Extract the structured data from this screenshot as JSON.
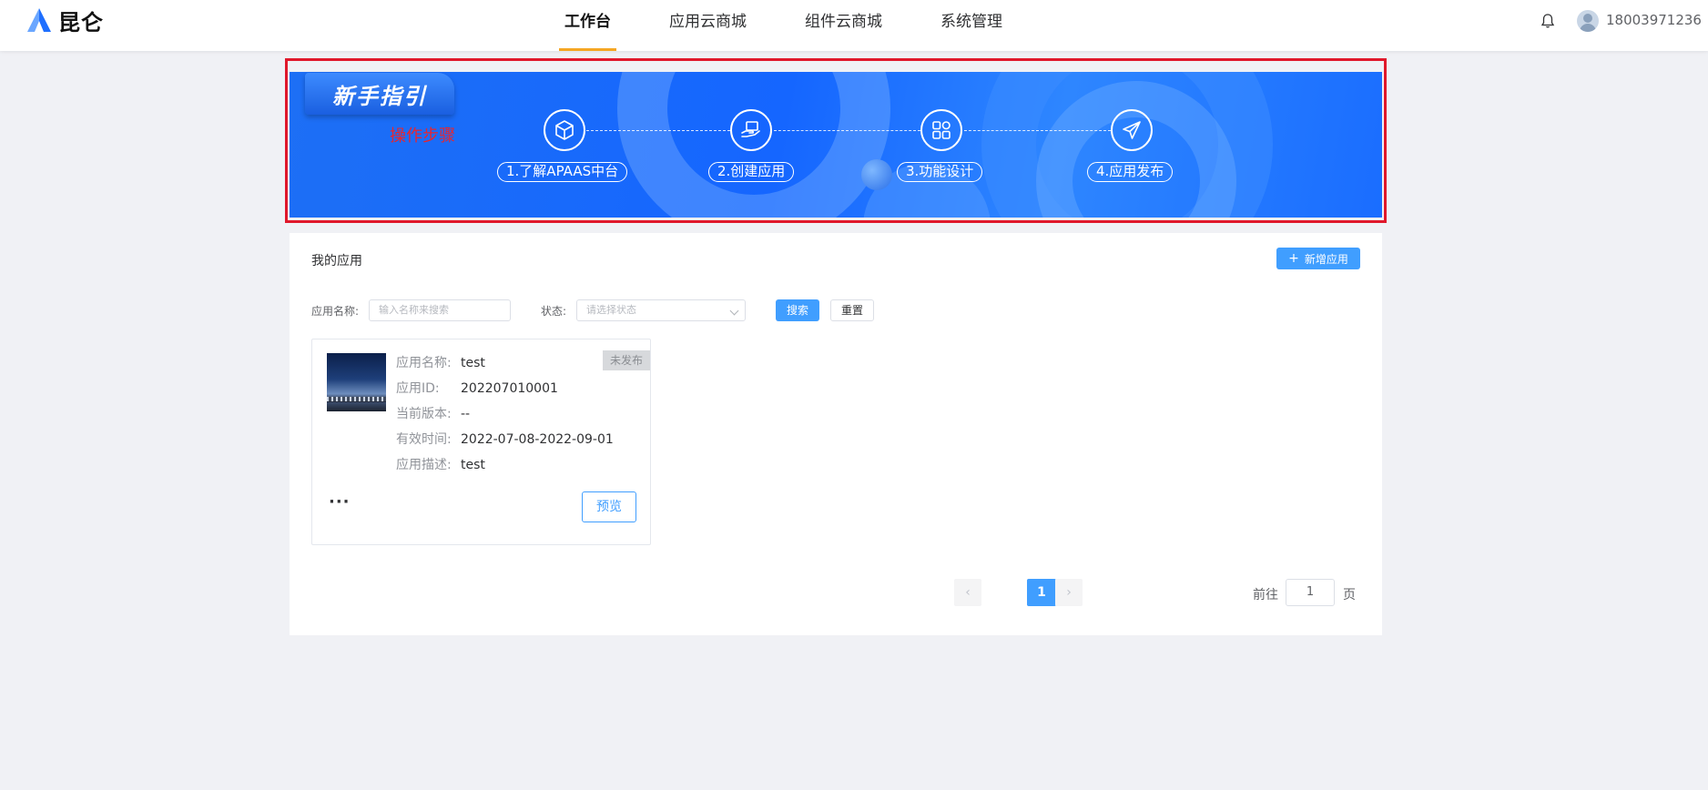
{
  "app": {
    "logo_text": "昆仑",
    "brand_color": "#1f6fff"
  },
  "nav": {
    "items": [
      {
        "label": "工作台",
        "active": true
      },
      {
        "label": "应用云商城",
        "active": false
      },
      {
        "label": "组件云商城",
        "active": false
      },
      {
        "label": "系统管理",
        "active": false
      }
    ]
  },
  "user": {
    "name": "18003971236",
    "notification_icon": "bell-icon"
  },
  "guide": {
    "title": "新手指引",
    "annotation": "操作步骤",
    "steps": [
      {
        "label": "1.了解APAAS中台",
        "icon": "cube-icon"
      },
      {
        "label": "2.创建应用",
        "icon": "hand-box-icon"
      },
      {
        "label": "3.功能设计",
        "icon": "grid-icon"
      },
      {
        "label": "4.应用发布",
        "icon": "paper-plane-icon"
      }
    ]
  },
  "my_apps": {
    "title": "我的应用",
    "add_label": "新增应用",
    "filters": {
      "name_label": "应用名称:",
      "name_placeholder": "输入名称来搜索",
      "status_label": "状态:",
      "status_placeholder": "请选择状态",
      "search_label": "搜索",
      "reset_label": "重置"
    },
    "cards": [
      {
        "status": "未发布",
        "rows": [
          {
            "key": "应用名称:",
            "value": "test"
          },
          {
            "key": "应用ID:",
            "value": "202207010001"
          },
          {
            "key": "当前版本:",
            "value": "--"
          },
          {
            "key": "有效时间:",
            "value": "2022-07-08-2022-09-01"
          },
          {
            "key": "应用描述:",
            "value": "test"
          }
        ],
        "more": "···",
        "preview_label": "预览"
      }
    ]
  },
  "pagination": {
    "prev": "‹",
    "current": "1",
    "next": "›",
    "goto_label": "前往",
    "goto_value": "1",
    "page_suffix": "页"
  },
  "colors": {
    "accent": "#409eff",
    "nav_underline": "#f5a623",
    "highlight_box": "#e0182b",
    "banner": "#1566ff"
  }
}
